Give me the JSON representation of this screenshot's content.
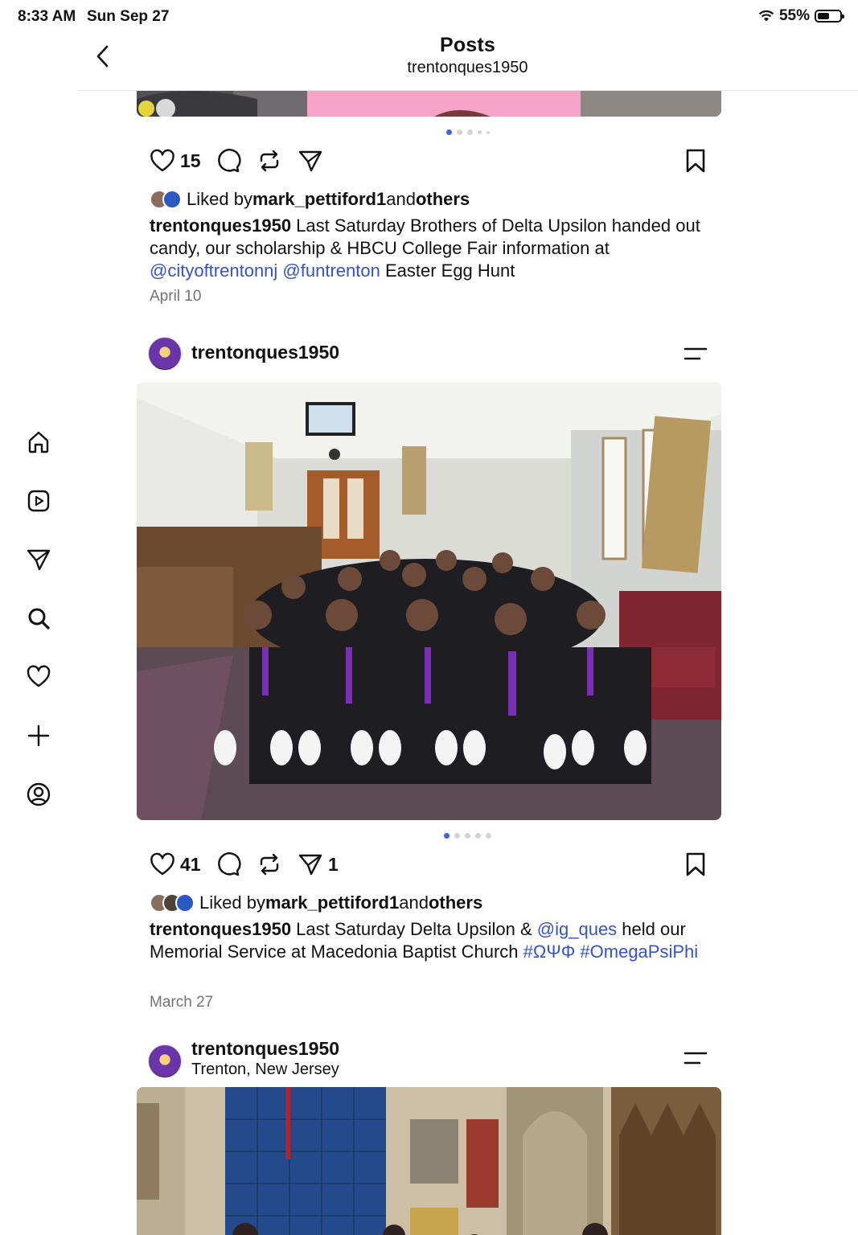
{
  "status_bar": {
    "time": "8:33 AM",
    "date": "Sun Sep 27",
    "battery": "55%",
    "battery_level": 0.55
  },
  "header": {
    "title": "Posts",
    "subtitle": "trentonques1950"
  },
  "sidebar": {
    "items": [
      {
        "name": "home-icon"
      },
      {
        "name": "reels-icon"
      },
      {
        "name": "send-icon"
      },
      {
        "name": "search-icon"
      },
      {
        "name": "heart-icon"
      },
      {
        "name": "create-icon"
      },
      {
        "name": "profile-icon"
      }
    ]
  },
  "posts": [
    {
      "likes": "15",
      "liked_by_prefix": "Liked by ",
      "liked_by_user": "mark_pettiford1",
      "liked_by_and": " and ",
      "liked_by_others": "others",
      "caption_user": "trentonques1950",
      "caption_text_1": " Last Saturday Brothers of Delta Upsilon handed out candy, our scholarship & HBCU College Fair information at ",
      "mention_1": "@cityoftrentonnj",
      "mention_2": "@funtrenton",
      "caption_text_2": " Easter Egg Hunt",
      "date": "April 10"
    },
    {
      "username": "trentonques1950",
      "likes": "41",
      "shares": "1",
      "liked_by_prefix": "Liked by ",
      "liked_by_user": "mark_pettiford1",
      "liked_by_and": " and ",
      "liked_by_others": "others",
      "caption_user": "trentonques1950",
      "caption_text_1": " Last Saturday Delta Upsilon & ",
      "mention_1": "@ig_ques",
      "caption_text_2": " held our Memorial Service at Macedonia Baptist Church ",
      "hashtag_1": "#ΩΨΦ",
      "hashtag_2": "#OmegaPsiPhi",
      "date": "March 27"
    },
    {
      "username": "trentonques1950",
      "location": "Trenton, New Jersey"
    }
  ],
  "colors": {
    "link": "#3452c9",
    "dot_active": "#3b63f0",
    "muted": "#737373"
  }
}
